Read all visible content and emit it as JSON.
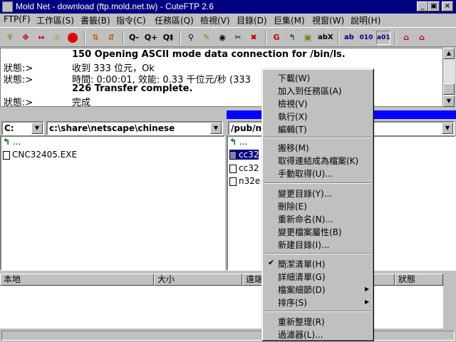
{
  "window": {
    "title": "Mold Net - download (ftp.mold.net.tw) - CuteFTP 2.6",
    "minimize": "_",
    "maximize": "▣",
    "close": "×"
  },
  "menubar": [
    "FTP(F)",
    "工作區(S)",
    "書籤(B)",
    "指令(C)",
    "任務區(Q)",
    "檢視(V)",
    "目錄(D)",
    "巨集(M)",
    "視窗(W)",
    "說明(H)"
  ],
  "toolbar": {
    "buttons": [
      "connect-icon",
      "quick-connect-icon",
      "disconnect-icon",
      "reconnect-icon",
      "stop-icon",
      "upload-icon",
      "download-icon",
      "q-minus",
      "q-plus",
      "q-run",
      "search-icon",
      "bookmark-icon",
      "binoculars-icon",
      "cut-icon",
      "delete-icon",
      "refresh-icon",
      "up-dir-icon",
      "view-icon",
      "abx-icon",
      "ascii-icon",
      "binary-icon",
      "auto-icon",
      "home-icon",
      "home2-icon"
    ],
    "labels": {
      "q_minus": "Q-",
      "q_plus": "Q+",
      "q_run": "Q‡",
      "abx": "abX",
      "ascii": "ab",
      "binary": "010",
      "auto": "a01"
    }
  },
  "log": [
    {
      "label": "",
      "message": "150 Opening ASCII mode data connection for /bin/ls."
    },
    {
      "label": "狀態:>",
      "message": "收到 333 位元，Ok"
    },
    {
      "label": "狀態:>",
      "message": "時間: 0:00:01, 效能: 0.33 千位元/秒 (333"
    },
    {
      "label": "",
      "message": "226 Transfer complete."
    },
    {
      "label": "狀態:>",
      "message": "完成"
    }
  ],
  "local": {
    "drive": "C:",
    "path": "c:\\share\\netscape\\chinese",
    "updir": "...",
    "files": [
      "CNC32405.EXE"
    ]
  },
  "remote": {
    "path": "/pub/nc",
    "updir": "...",
    "files": [
      "cc32",
      "cc32",
      "n32e"
    ]
  },
  "queue": {
    "columns": [
      "本地",
      "大小",
      "遠端",
      "狀態"
    ]
  },
  "context_menu": {
    "group1": [
      "下載(W)",
      "加入到任務區(A)",
      "檢視(V)",
      "執行(X)",
      "編輯(T)"
    ],
    "group2": [
      "搬移(M)",
      "取得連結成為檔案(K)",
      "手動取得(U)..."
    ],
    "group3": [
      "變更目錄(Y)...",
      "刪除(E)",
      "重新命名(N)...",
      "變更檔案屬性(B)",
      "新建目錄(I)..."
    ],
    "group4": [
      "簡潔清單(H)",
      "詳細清單(G)",
      "檔案細節(D)",
      "排序(S)"
    ],
    "group5": [
      "重新整理(R)",
      "過濾器(L)..."
    ],
    "checked": "✔",
    "submenu_arrow": "▶"
  }
}
